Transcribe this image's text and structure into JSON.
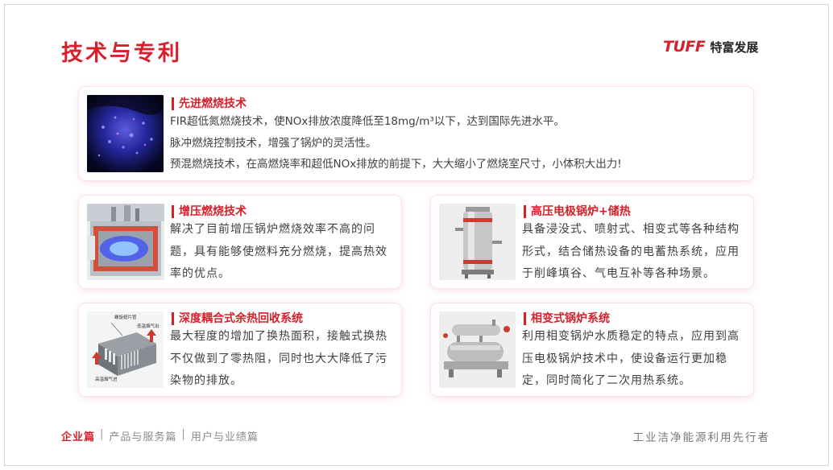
{
  "page": {
    "title": "技术与专利",
    "logo_mark": "TUFF",
    "logo_text": "特富发展",
    "accent_color": "#d6202c"
  },
  "cards": {
    "combustion": {
      "heading": "先进燃烧技术",
      "image_icon": "blue-flame-image",
      "lines": [
        "FIR超低氮燃烧技术，使NOx排放浓度降低至18mg/m³以下，达到国际先进水平。",
        "脉冲燃烧控制技术，增强了锅炉的灵活性。",
        "预混燃烧技术，在高燃烧率和超低NOx排放的前提下，大大缩小了燃烧室尺寸，小体积大出力!"
      ]
    },
    "pressurized": {
      "heading": "增压燃烧技术",
      "image_icon": "pressurized-furnace-image",
      "text": "解决了目前增压锅炉燃烧效率不高的问题，具有能够使燃料充分燃烧，提高热效率的优点。"
    },
    "electrode": {
      "heading": "高压电极锅炉+储热",
      "image_icon": "electrode-boiler-image",
      "text": "具备浸没式、喷射式、相变式等各种结构形式，结合储热设备的电蓄热系统，应用于削峰填谷、气电互补等各种场景。"
    },
    "heat_recovery": {
      "heading": "深度耦合式余热回收系统",
      "image_icon": "heat-recovery-diagram",
      "labels": {
        "top": "螺旋翅片管",
        "right": "低温烟气出",
        "bottom": "高温烟气进"
      },
      "text": "最大程度的增加了换热面积，接触式换热不仅做到了零热阻，同时也大大降低了污染物的排放。"
    },
    "phase_change": {
      "heading": "相变式锅炉系统",
      "image_icon": "phase-change-boiler-image",
      "text": "利用相变锅炉水质稳定的特点，应用到高压电极锅炉技术中，使设备运行更加稳定，同时简化了二次用热系统。"
    }
  },
  "footer": {
    "nav": [
      "企业篇",
      "产品与服务篇",
      "用户与业绩篇"
    ],
    "active_index": 0,
    "slogan": "工业洁净能源利用先行者"
  }
}
